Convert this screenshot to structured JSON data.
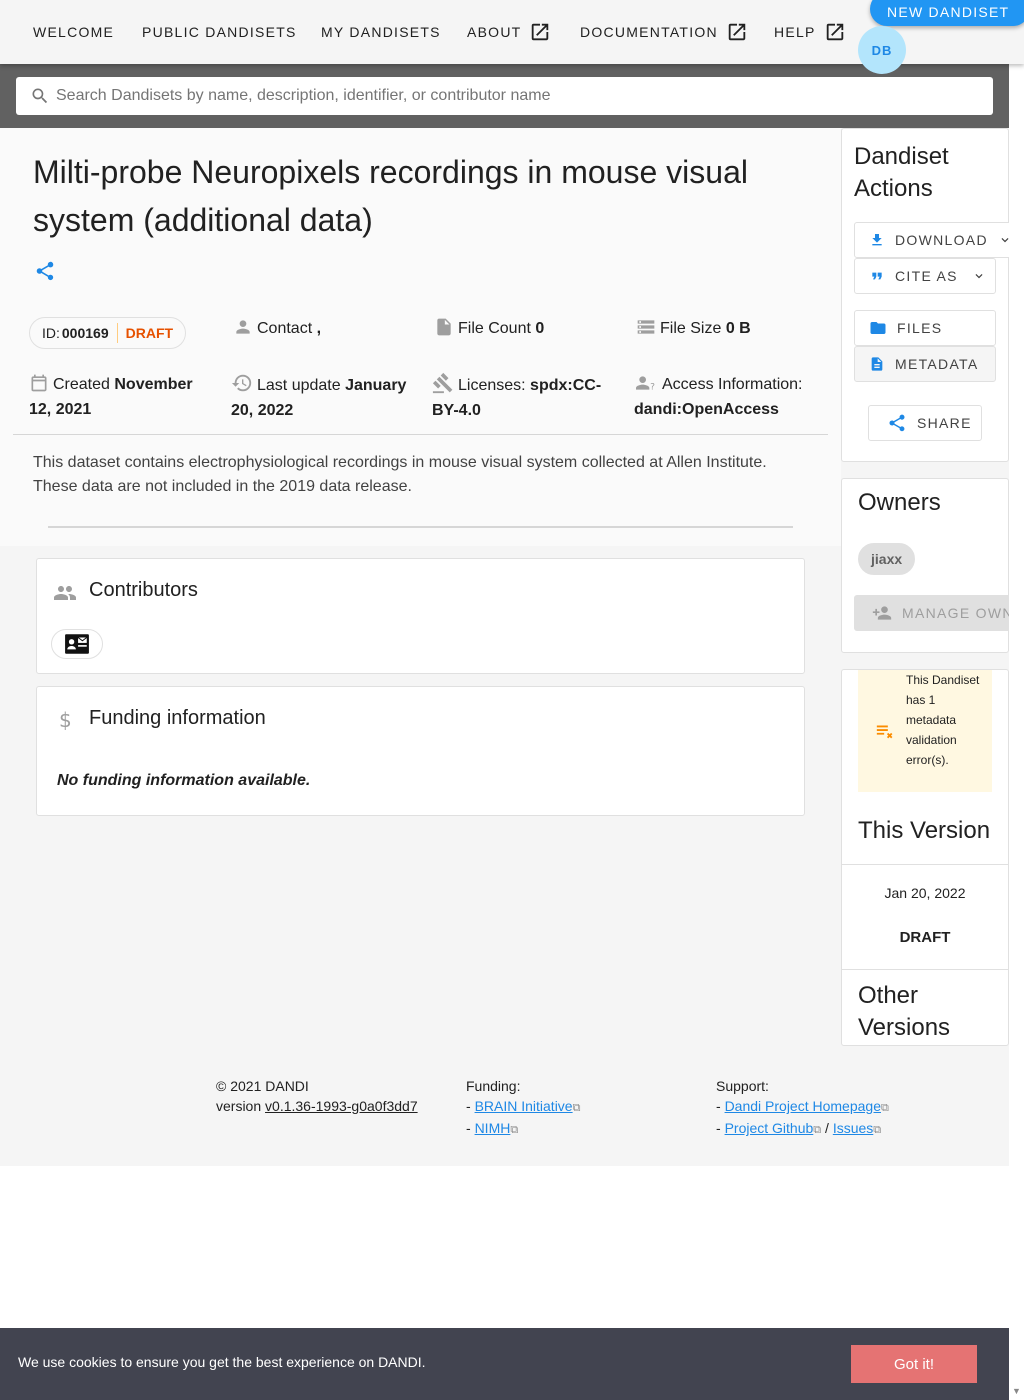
{
  "nav": {
    "items": [
      {
        "label": "WELCOME",
        "external": false
      },
      {
        "label": "PUBLIC DANDISETS",
        "external": false
      },
      {
        "label": "MY DANDISETS",
        "external": false
      },
      {
        "label": "ABOUT",
        "external": true
      },
      {
        "label": "DOCUMENTATION",
        "external": true
      },
      {
        "label": "HELP",
        "external": true
      }
    ],
    "new_dandiset": "NEW DANDISET",
    "avatar_initials": "DB"
  },
  "search": {
    "placeholder": "Search Dandisets by name, description, identifier, or contributor name"
  },
  "dandiset": {
    "title": "Milti-probe Neuropixels recordings in mouse visual system (additional data)",
    "id_label": "ID:",
    "id": "000169",
    "status": "DRAFT",
    "contact_label": "Contact",
    "contact_value": ",",
    "file_count_label": "File Count",
    "file_count": "0",
    "file_size_label": "File Size",
    "file_size": "0 B",
    "created_label": "Created",
    "created": "November 12, 2021",
    "last_update_label": "Last update",
    "last_update": "January 20, 2022",
    "licenses_label": "Licenses:",
    "licenses": "spdx:CC-BY-4.0",
    "access_label": "Access Information:",
    "access": "dandi:OpenAccess",
    "description": "This dataset contains electrophysiological recordings in mouse visual system collected at Allen Institute. These data are not included in the 2019 data release."
  },
  "contributors": {
    "title": "Contributors"
  },
  "funding": {
    "title": "Funding information",
    "empty": "No funding information available."
  },
  "actions": {
    "title": "Dandiset Actions",
    "download": "DOWNLOAD",
    "cite_as": "CITE AS",
    "files": "FILES",
    "metadata": "METADATA",
    "share": "SHARE"
  },
  "owners": {
    "title": "Owners",
    "list": [
      "jiaxx"
    ],
    "manage": "MANAGE OWNERS"
  },
  "validation": {
    "message": "This Dandiset has 1 metadata validation error(s)."
  },
  "versions": {
    "this_title": "This Version",
    "date": "Jan 20, 2022",
    "status": "DRAFT",
    "other_title": "Other Versions"
  },
  "footer": {
    "copyright": "© 2021 DANDI",
    "version_label": "version",
    "version": "v0.1.36-1993-g0a0f3dd7",
    "funding_label": "Funding:",
    "funding_links": [
      "BRAIN Initiative",
      "NIMH"
    ],
    "support_label": "Support:",
    "support_links": [
      "Dandi Project Homepage",
      "Project Github",
      "Issues"
    ]
  },
  "cookie": {
    "message": "We use cookies to ensure you get the best experience on DANDI.",
    "button": "Got it!"
  },
  "colors": {
    "primary": "#2196f3",
    "draft": "#e65100",
    "warning": "#fb8c00",
    "cookie_bg": "#424450",
    "cookie_btn": "#e57373"
  }
}
